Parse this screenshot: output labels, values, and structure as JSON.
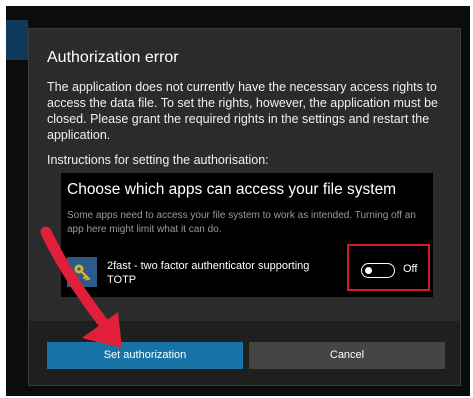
{
  "dialog": {
    "title": "Authorization error",
    "body": "The application does not currently have the necessary access rights to access the data file. To set the rights, however, the application must be closed. Please grant the required rights in the settings and restart the application.",
    "instructions": "Instructions for setting the authorisation:"
  },
  "settings_screenshot": {
    "heading": "Choose which apps can access your file system",
    "description": "Some apps need to access your file system to work as intended. Turning off an app here might limit what it can do.",
    "app_name": "2fast - two factor authenticator supporting TOTP",
    "app_icon": "key-icon",
    "toggle_label": "Off",
    "toggle_state": "off"
  },
  "buttons": {
    "primary_label": "Set authorization",
    "secondary_label": "Cancel"
  },
  "colors": {
    "dialog_bg": "#2b2b2b",
    "footer_bg": "#1f1f1f",
    "primary_button": "#1873a6",
    "secondary_button": "#454545",
    "annotation_red": "#d81b2a"
  }
}
